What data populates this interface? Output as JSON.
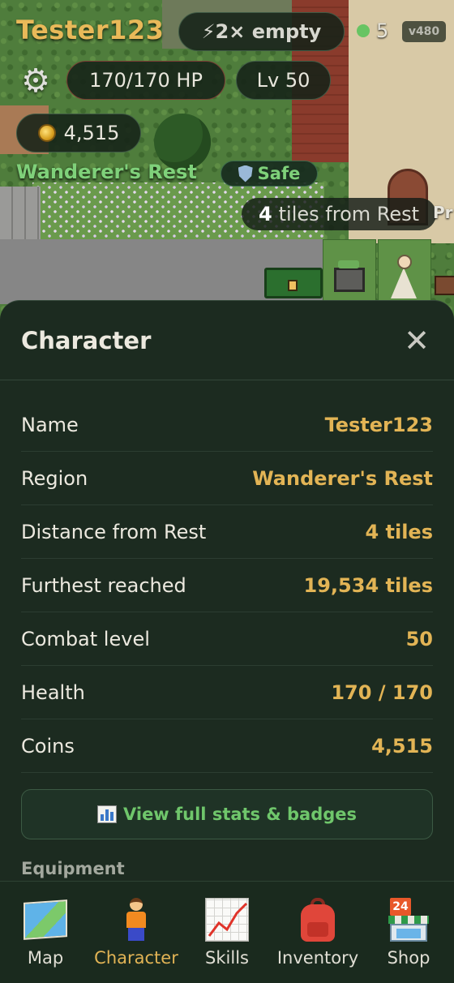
{
  "hud": {
    "player_name": "Tester123",
    "boost_label": "⚡2× empty",
    "online_count": "5",
    "version": "v480",
    "hp": "170/170 HP",
    "level": "Lv 50",
    "coins": "4,515",
    "region": "Wanderer's Rest",
    "safe_label": "Safe",
    "tiles_number": "4",
    "tiles_text": "tiles from Rest",
    "offscreen_label": "Pr"
  },
  "sheet": {
    "title": "Character",
    "close_symbol": "✕",
    "rows": [
      {
        "label": "Name",
        "value": "Tester123"
      },
      {
        "label": "Region",
        "value": "Wanderer's Rest"
      },
      {
        "label": "Distance from Rest",
        "value": "4 tiles"
      },
      {
        "label": "Furthest reached",
        "value": "19,534 tiles"
      },
      {
        "label": "Combat level",
        "value": "50"
      },
      {
        "label": "Health",
        "value": "170 / 170"
      },
      {
        "label": "Coins",
        "value": "4,515"
      }
    ],
    "stats_button": "View full stats & badges",
    "equipment_heading": "Equipment"
  },
  "nav": {
    "items": [
      {
        "label": "Map",
        "icon": "map-icon"
      },
      {
        "label": "Character",
        "icon": "character-icon",
        "active": true
      },
      {
        "label": "Skills",
        "icon": "skills-chart-icon"
      },
      {
        "label": "Inventory",
        "icon": "backpack-icon"
      },
      {
        "label": "Shop",
        "icon": "shop-icon"
      }
    ]
  },
  "colors": {
    "gold": "#e2b455",
    "green": "#7fd17a",
    "panel": "#1c2b20"
  }
}
